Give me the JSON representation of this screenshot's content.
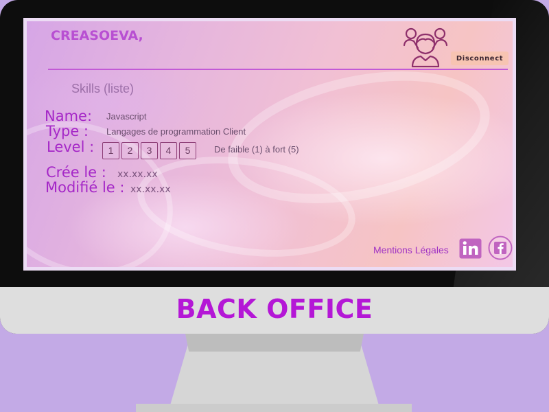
{
  "app": {
    "brand": "CREASOEVA,",
    "disconnect_label": "Disconnect"
  },
  "section": {
    "title": "Skills (liste)"
  },
  "skill": {
    "name_label": "Name:",
    "name_value": "Javascript",
    "type_label": "Type :",
    "type_value": "Langages de programmation Client",
    "level_label": "Level :",
    "levels": [
      "1",
      "2",
      "3",
      "4",
      "5"
    ],
    "level_hint": "De faible (1) à fort (5)",
    "created_label": "Crée le :",
    "created_value": "xx.xx.xx",
    "modified_label": "Modifié le :",
    "modified_value": "xx.xx.xx"
  },
  "footer": {
    "legal_label": "Mentions Légales",
    "social": [
      "linkedin-icon",
      "facebook-icon"
    ]
  },
  "device": {
    "caption": "BACK OFFICE"
  },
  "colors": {
    "accent": "#b417d6",
    "label": "#a527c7",
    "background": "#c3aae6",
    "button": "#f7c4b2"
  }
}
